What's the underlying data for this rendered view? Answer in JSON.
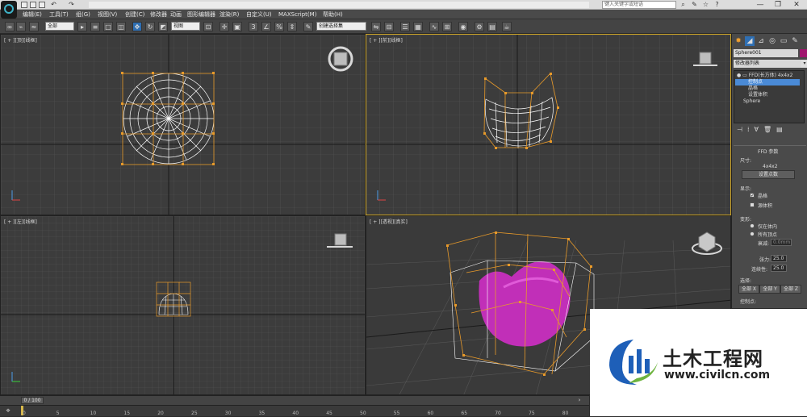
{
  "app": {
    "quick_access": [
      "□",
      "▭",
      "▣",
      "↶",
      "↷"
    ],
    "search_placeholder": "键入关键字或短语",
    "window_controls": [
      "—",
      "❐",
      "✕"
    ]
  },
  "menu": [
    "编辑(E)",
    "工具(T)",
    "组(G)",
    "视图(V)",
    "创建(C)",
    "修改器",
    "动画",
    "图形编辑器",
    "渲染(R)",
    "自定义(U)",
    "MAXScript(M)",
    "帮助(H)"
  ],
  "toolbar": {
    "selection_filter": "全部",
    "reference_coord": "视图",
    "named_selection": "创建选择集"
  },
  "viewports": {
    "top": "[ + ][顶][线框]",
    "front": "[ + ][前][线框]",
    "left": "[ + ][左][线框]",
    "perspective": "[ + ][透视][真实]"
  },
  "panel": {
    "object_name": "Sphere001",
    "modifier_list": "修改器列表",
    "stack": [
      {
        "label": "FFD(长方体) 4x4x2",
        "selected": false
      },
      {
        "label": "控制点",
        "selected": true
      },
      {
        "label": "晶格",
        "selected": false
      },
      {
        "label": "设置体积",
        "selected": false
      },
      {
        "label": "Sphere",
        "selected": false
      }
    ],
    "rollout_title": "FFD 参数",
    "dimensions_label": "尺寸:",
    "dimensions_value": "4x4x2",
    "set_points_button": "设置点数",
    "display_label": "显示:",
    "lattice_label": "晶格",
    "source_volume_label": "源体积",
    "deform_label": "变形:",
    "only_in_volume": "仅在体内",
    "all_vertices": "所有顶点",
    "falloff_label": "衰减:",
    "falloff_value": "0.0mm",
    "tension_label": "张力:",
    "tension_value": "25.0",
    "continuity_label": "连续性:",
    "continuity_value": "25.0",
    "selection_label": "选择:",
    "all_x": "全部 X",
    "all_y": "全部 Y",
    "all_z": "全部 Z",
    "control_points_label": "控制点:"
  },
  "timeline": {
    "frame": "0 / 100",
    "ticks": [
      "0",
      "5",
      "10",
      "15",
      "20",
      "25",
      "30",
      "35",
      "40",
      "45",
      "50",
      "55",
      "60",
      "65",
      "70",
      "75",
      "80",
      "85"
    ]
  },
  "watermark": {
    "title": "土木工程网",
    "url": "www.civilcn.com"
  }
}
